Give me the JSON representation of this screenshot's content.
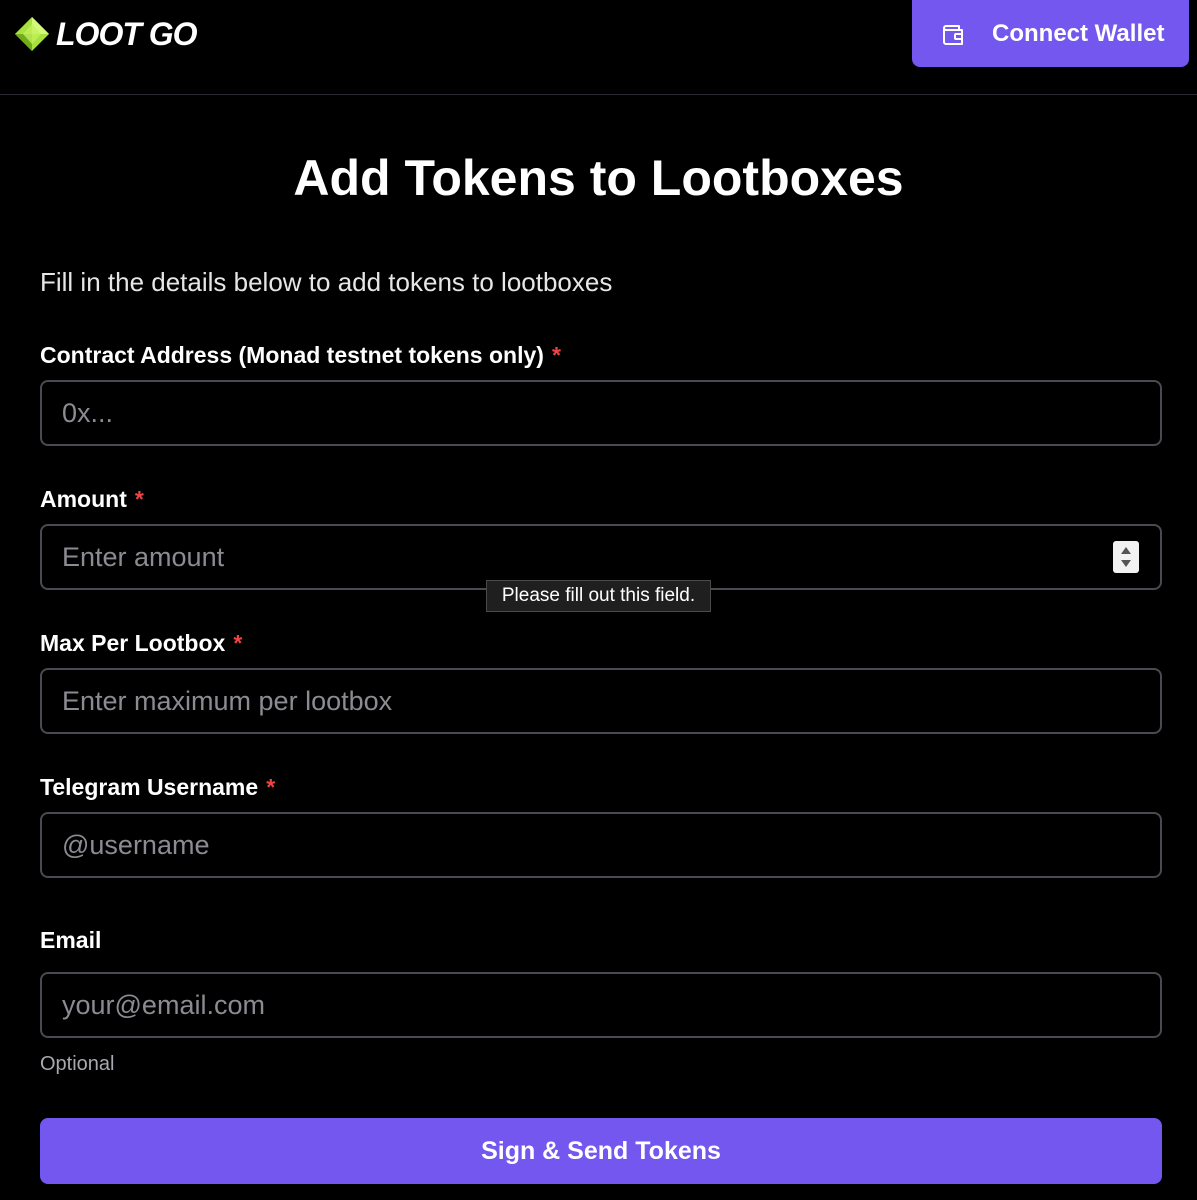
{
  "header": {
    "logo_text": "LOOT GO",
    "logo_icon": "diamond-gem-icon",
    "connect_wallet_label": "Connect Wallet",
    "connect_wallet_icon": "wallet-icon"
  },
  "page": {
    "title": "Add Tokens to Lootboxes",
    "subtitle": "Fill in the details below to add tokens to lootboxes"
  },
  "form": {
    "contract_address": {
      "label": "Contract Address (Monad testnet tokens only)",
      "required_mark": "*",
      "placeholder": "0x...",
      "value": ""
    },
    "amount": {
      "label": "Amount",
      "required_mark": "*",
      "placeholder": "Enter amount",
      "value": "",
      "validation_tooltip": "Please fill out this field."
    },
    "max_per_lootbox": {
      "label": "Max Per Lootbox",
      "required_mark": "*",
      "placeholder": "Enter maximum per lootbox",
      "value": ""
    },
    "telegram_username": {
      "label": "Telegram Username",
      "required_mark": "*",
      "placeholder": "@username",
      "value": ""
    },
    "email": {
      "label": "Email",
      "placeholder": "your@email.com",
      "value": "",
      "hint": "Optional"
    },
    "submit_label": "Sign & Send Tokens"
  },
  "colors": {
    "background": "#000000",
    "accent": "#7357ee",
    "required": "#ef4444",
    "input_border": "#4a4a52",
    "placeholder": "#8b8b92",
    "logo_gem_light": "#c8f56a",
    "logo_gem_dark": "#7dbf1f"
  }
}
